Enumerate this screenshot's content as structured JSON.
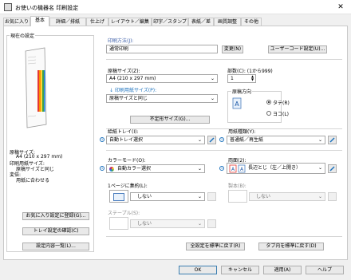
{
  "window": {
    "title": "お使いの機器名 印刷設定",
    "close_icon": "close-icon"
  },
  "tabs": [
    "お気に入り",
    "基本",
    "詳細",
    "排紙",
    "仕上げ",
    "レイアウト／編集",
    "印字／スタンプ",
    "表紙／差",
    "画質調整",
    "その他"
  ],
  "left": {
    "current_settings_label": "現在の設定",
    "summary": {
      "paper_size_label": "原稿サイズ:",
      "paper_size_value": "A4 (210 x 297 mm)",
      "print_size_label": "印刷用紙サイズ:",
      "print_size_value": "原稿サイズと同じ",
      "scale_label": "変倍:",
      "scale_value": "用紙に合わせる"
    },
    "register_button": "お気に入り設定に登録(G)...",
    "tray_check_button": "トレイ設定の確認(C)",
    "settings_list_button": "設定内容一覧(L)..."
  },
  "print_method": {
    "label": "印刷方法(J):",
    "value": "通常印刷",
    "change_button": "変更(N)",
    "user_code_button": "ユーザーコード設定(U)..."
  },
  "paper_size": {
    "label": "原稿サイズ(Z):",
    "value": "A4 (210 x 297 mm)"
  },
  "print_paper_size": {
    "label": "印刷用紙サイズ(P):",
    "value": "原稿サイズと同じ"
  },
  "copies": {
    "label": "部数(C): (1から999)",
    "value": "1"
  },
  "orientation": {
    "label": "原稿方向",
    "portrait": "タテ(R)",
    "landscape": "ヨコ(L)",
    "selected": "portrait"
  },
  "custom_size_button": "不定形サイズ(G)...",
  "paper_tray": {
    "label": "給紙トレイ(I):",
    "value": "自動トレイ選択"
  },
  "paper_type": {
    "label": "用紙種類(Y):",
    "value": "普通紙／再生紙"
  },
  "color_mode": {
    "label": "カラーモード(O):",
    "value": "自動カラー選択"
  },
  "duplex": {
    "label": "両面(2):",
    "value": "長辺とじ（左／上開き）"
  },
  "combine": {
    "label": "1ページに集約(L):",
    "value": "しない"
  },
  "booklet": {
    "label": "製本(B):",
    "value": "しない"
  },
  "staple": {
    "label": "ステープル(S):",
    "value": "しない"
  },
  "reset_buttons": {
    "all_defaults": "全設定を標準に戻す(R)",
    "tab_defaults": "タブ内を標準に戻す(D)"
  },
  "footer": {
    "ok": "OK",
    "cancel": "キャンセル",
    "apply": "適用(A)",
    "help": "ヘルプ"
  },
  "colors": {
    "accent": "#1e73be",
    "link_blue": "#3c5ea8"
  }
}
